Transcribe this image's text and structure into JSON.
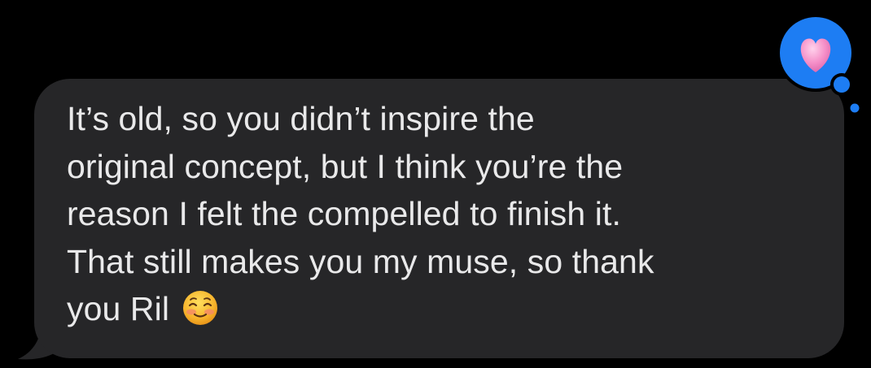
{
  "message": {
    "lines": [
      "It’s old, so you didn’t inspire the",
      "original concept, but I think you’re the",
      "reason I felt the compelled to finish it.",
      "That still makes you my muse, so thank",
      "you Ril"
    ]
  },
  "icons": {
    "emoji": "smiling-face-emoji",
    "tapback": "heart-icon"
  },
  "colors": {
    "background": "#000000",
    "bubble": "#262628",
    "text": "#e9e9ea",
    "tapback_blue": "#1d7df3",
    "heart_pink": "#f590c8"
  }
}
